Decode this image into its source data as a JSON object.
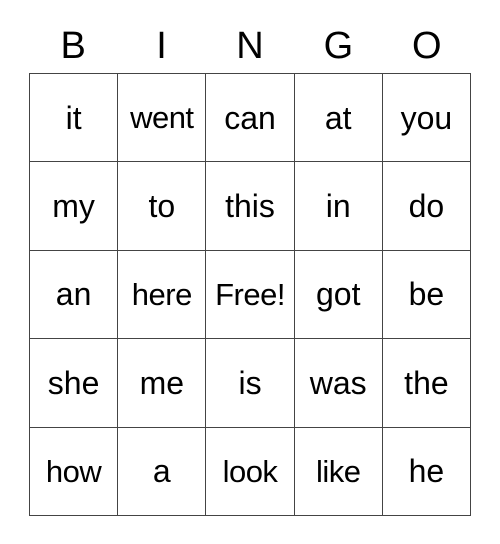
{
  "card": {
    "title": "BINGO",
    "headers": [
      "B",
      "I",
      "N",
      "G",
      "O"
    ],
    "free_space_label": "Free!",
    "rows": [
      [
        "it",
        "went",
        "can",
        "at",
        "you"
      ],
      [
        "my",
        "to",
        "this",
        "in",
        "do"
      ],
      [
        "an",
        "here",
        "Free!",
        "got",
        "be"
      ],
      [
        "she",
        "me",
        "is",
        "was",
        "the"
      ],
      [
        "how",
        "a",
        "look",
        "like",
        "he"
      ]
    ]
  },
  "colors": {
    "border": "#444444",
    "text": "#000000",
    "background": "#ffffff"
  }
}
